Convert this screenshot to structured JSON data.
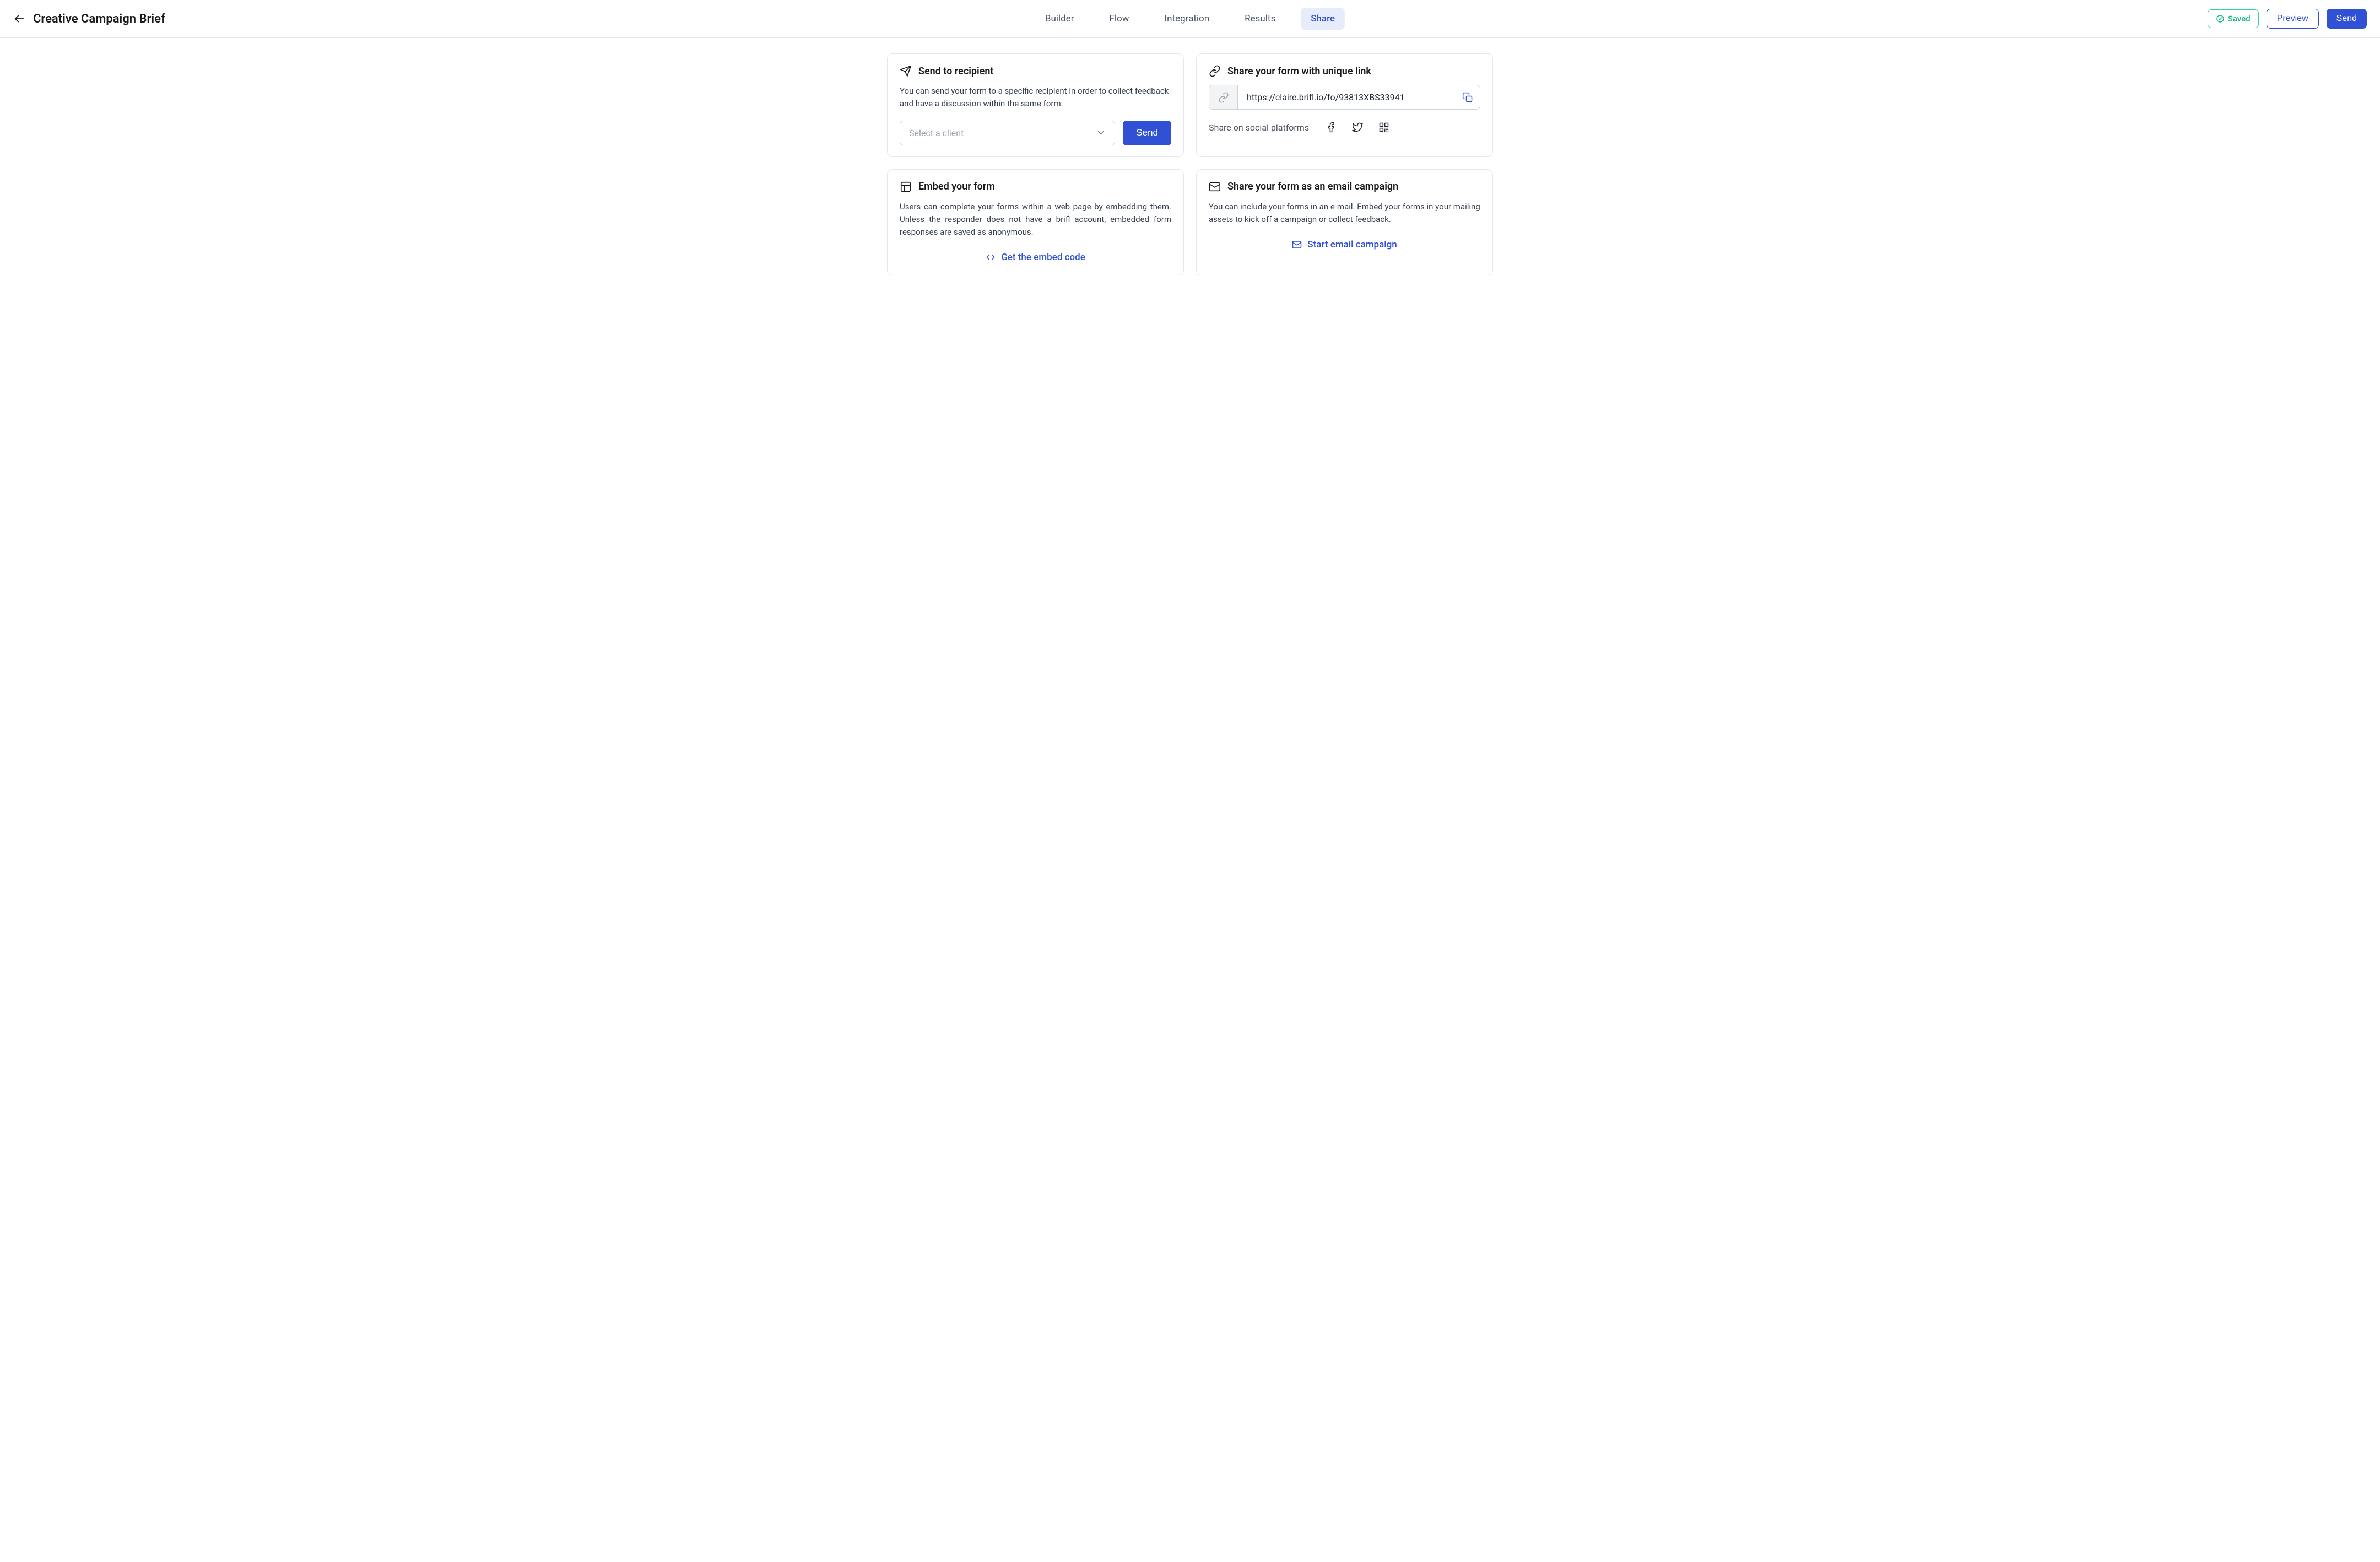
{
  "header": {
    "title": "Creative Campaign Brief",
    "nav": {
      "builder": "Builder",
      "flow": "Flow",
      "integration": "Integration",
      "results": "Results",
      "share": "Share"
    },
    "saved_label": "Saved",
    "preview_label": "Preview",
    "send_label": "Send"
  },
  "cards": {
    "recipient": {
      "title": "Send to recipient",
      "desc": "You can send your form to a specific recipient in order to collect feedback and have a discussion within the same form.",
      "select_placeholder": "Select a client",
      "send_label": "Send"
    },
    "link": {
      "title": "Share your form with unique link",
      "url": "https://claire.brifl.io/fo/93813XBS33941",
      "social_label": "Share on social platforms"
    },
    "embed": {
      "title": "Embed your form",
      "desc": "Users can complete your forms within a web page by embedding them. Unless the responder does not have a brifl account, embedded form responses are saved as anonymous.",
      "action_label": "Get the embed code"
    },
    "email": {
      "title": "Share your form as an email campaign",
      "desc": "You can include your forms in an e-mail. Embed your forms in your mailing assets to kick off a campaign or collect feedback.",
      "action_label": "Start email campaign"
    }
  }
}
